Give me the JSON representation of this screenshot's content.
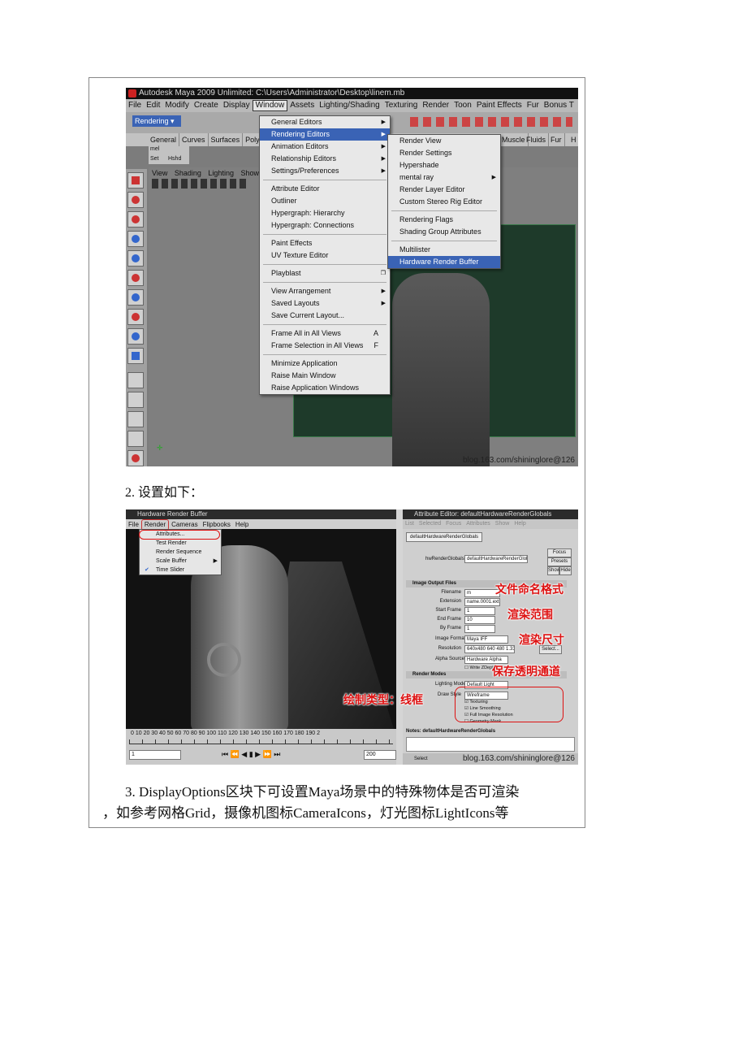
{
  "screenshot1": {
    "title": "Autodesk Maya 2009 Unlimited: C:\\Users\\Administrator\\Desktop\\linem.mb",
    "menubar": [
      "File",
      "Edit",
      "Modify",
      "Create",
      "Display",
      "Window",
      "Assets",
      "Lighting/Shading",
      "Texturing",
      "Render",
      "Toon",
      "Paint Effects",
      "Fur",
      "Bonus T"
    ],
    "mode_dropdown": "Rendering",
    "shelf_tabs_left": [
      "General",
      "Curves",
      "Surfaces",
      "Polygons"
    ],
    "shelf_tabs_right": [
      "Muscle",
      "Fluids",
      "Fur",
      "H"
    ],
    "shelf_buttons": [
      "mel",
      "Set",
      "Hshd"
    ],
    "panel_menu": [
      "View",
      "Shading",
      "Lighting",
      "Show"
    ],
    "window_menu": {
      "group1": [
        "General Editors",
        "Rendering Editors",
        "Animation Editors",
        "Relationship Editors",
        "Settings/Preferences"
      ],
      "group2": [
        "Attribute Editor",
        "Outliner",
        "Hypergraph: Hierarchy",
        "Hypergraph: Connections"
      ],
      "group3": [
        "Paint Effects",
        "UV Texture Editor"
      ],
      "group4": [
        "Playblast"
      ],
      "group5": [
        "View Arrangement",
        "Saved Layouts",
        "Save Current Layout..."
      ],
      "group6": [
        {
          "label": "Frame All in All Views",
          "key": "A"
        },
        {
          "label": "Frame Selection in All Views",
          "key": "F"
        }
      ],
      "group7": [
        "Minimize Application",
        "Raise Main Window",
        "Raise Application Windows"
      ]
    },
    "rendering_submenu": {
      "group1": [
        "Render View",
        "Render Settings",
        "Hypershade",
        "mental ray",
        "Render Layer Editor",
        "Custom Stereo Rig Editor"
      ],
      "group2": [
        "Rendering Flags",
        "Shading Group Attributes"
      ],
      "group3": [
        "Multilister",
        "Hardware Render Buffer"
      ]
    },
    "watermark": "blog.163.com/shininglore@126"
  },
  "caption2": "2. 设置如下：",
  "screenshot2": {
    "hrb_title": "Hardware Render Buffer",
    "hrb_menu": [
      "File",
      "Render",
      "Cameras",
      "Flipbooks",
      "Help"
    ],
    "render_menu": [
      "Attributes...",
      "Test Render",
      "Render Sequence",
      "Scale Buffer",
      "Time Slider"
    ],
    "timeline_numbers": "0 10 20 30 40 50 60 70 80 90 100 110 120 130 140 150 160 170 180 190 2",
    "timeline_start": "1",
    "timeline_end": "200",
    "ae_title": "Attribute Editor: defaultHardwareRenderGlobals",
    "ae_menu": [
      "List",
      "Selected",
      "Focus",
      "Attributes",
      "Show",
      "Help"
    ],
    "ae_tab": "defaultHardwareRenderGlobals",
    "ae_node_label": "hwRenderGlobals:",
    "ae_node_value": "defaultHardwareRenderGlobals",
    "ae_buttons": [
      "Focus",
      "Presets",
      "Show",
      "Hide"
    ],
    "section_image_output": "Image Output Files",
    "fields": [
      {
        "label": "Filename",
        "value": "m"
      },
      {
        "label": "Extension",
        "value": "name.0001.ext"
      },
      {
        "label": "Start Frame",
        "value": "1"
      },
      {
        "label": "End Frame",
        "value": "10"
      },
      {
        "label": "By Frame",
        "value": "1"
      },
      {
        "label": "Image Format",
        "value": "Maya IFF"
      },
      {
        "label": "Resolution",
        "value": "640x480 640 480 1.333"
      },
      {
        "label": "Alpha Source",
        "value": "Hardware Alpha"
      }
    ],
    "select_button": "Select...",
    "write_zdepth": "Write ZDepth",
    "section_render_modes": "Render Modes",
    "lighting_mode_label": "Lighting Mode",
    "lighting_mode_value": "Default Light",
    "draw_style_label": "Draw Style",
    "draw_style_value": "Wireframe",
    "checkboxes": [
      "Texturing",
      "Line Smoothing",
      "Full Image Resolution",
      "Geometry Mask"
    ],
    "notes_label": "Notes: defaultHardwareRenderGlobals",
    "bottom_button": "Select",
    "annotations": {
      "file_naming": "文件命名格式",
      "render_range": "渲染范围",
      "render_size": "渲染尺寸",
      "save_alpha": "保存透明通道",
      "draw_type": "绘制类型：线框"
    },
    "watermark": "blog.163.com/shininglore@126"
  },
  "para3": {
    "line1": "3. DisplayOptions区块下可设置Maya场景中的特殊物体是否可渲染",
    "line2": "，如参考网格Grid，摄像机图标CameraIcons，灯光图标LightIcons等"
  }
}
